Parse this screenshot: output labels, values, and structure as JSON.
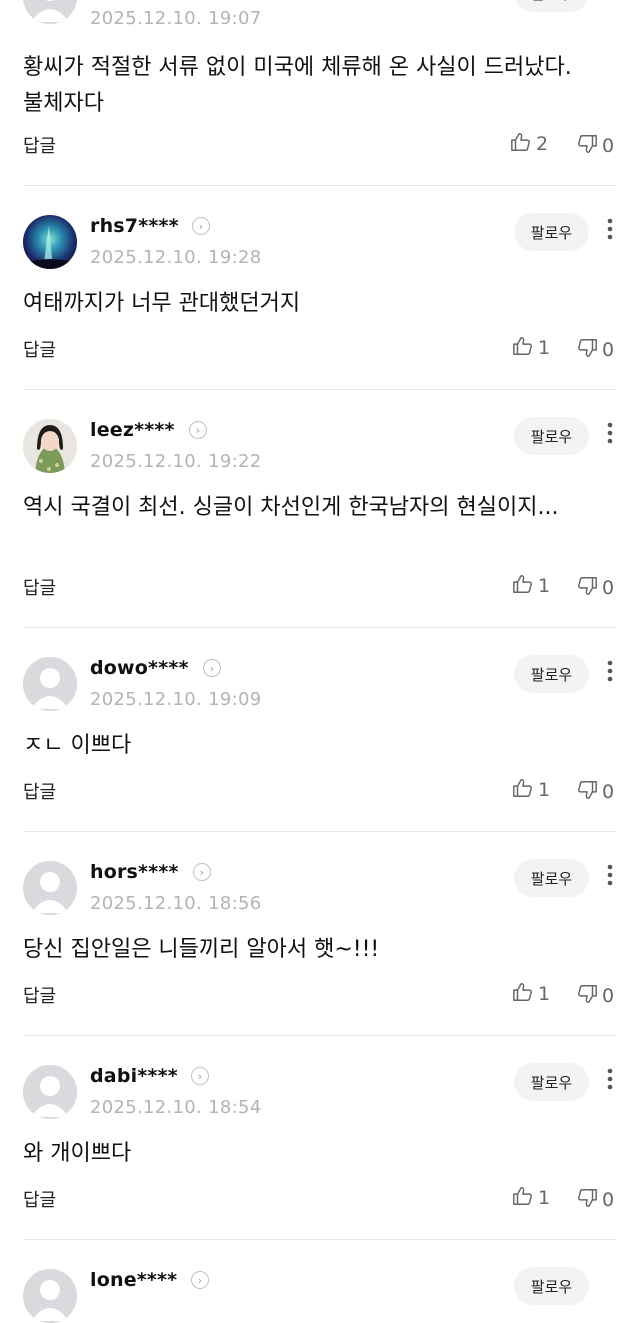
{
  "ui": {
    "follow_label": "팔로우",
    "reply_label": "답글"
  },
  "comments": [
    {
      "username": "",
      "timestamp": "2025.12.10. 19:07",
      "text": "황씨가 적절한 서류 없이 미국에 체류해 온 사실이 드러났다. 불체자다",
      "likes": "2",
      "dislikes": "0",
      "avatar": "default-avatar"
    },
    {
      "username": "rhs7****",
      "timestamp": "2025.12.10. 19:28",
      "text": "여태까지가 너무 관대했던거지",
      "likes": "1",
      "dislikes": "0",
      "avatar": "aurora-photo"
    },
    {
      "username": "leez****",
      "timestamp": "2025.12.10. 19:22",
      "text": "역시 국결이 최선. 싱글이 차선인게 한국남자의 현실이지...",
      "likes": "1",
      "dislikes": "0",
      "avatar": "person-photo"
    },
    {
      "username": "dowo****",
      "timestamp": "2025.12.10. 19:09",
      "text": "ㅈㄴ 이쁘다",
      "likes": "1",
      "dislikes": "0",
      "avatar": "default-avatar"
    },
    {
      "username": "hors****",
      "timestamp": "2025.12.10. 18:56",
      "text": "당신 집안일은 니들끼리 알아서 햇~!!!",
      "likes": "1",
      "dislikes": "0",
      "avatar": "default-avatar"
    },
    {
      "username": "dabi****",
      "timestamp": "2025.12.10. 18:54",
      "text": "와 개이쁘다",
      "likes": "1",
      "dislikes": "0",
      "avatar": "default-avatar"
    },
    {
      "username": "lone****",
      "timestamp": "",
      "text": "",
      "likes": "",
      "dislikes": "",
      "avatar": "default-avatar"
    }
  ]
}
